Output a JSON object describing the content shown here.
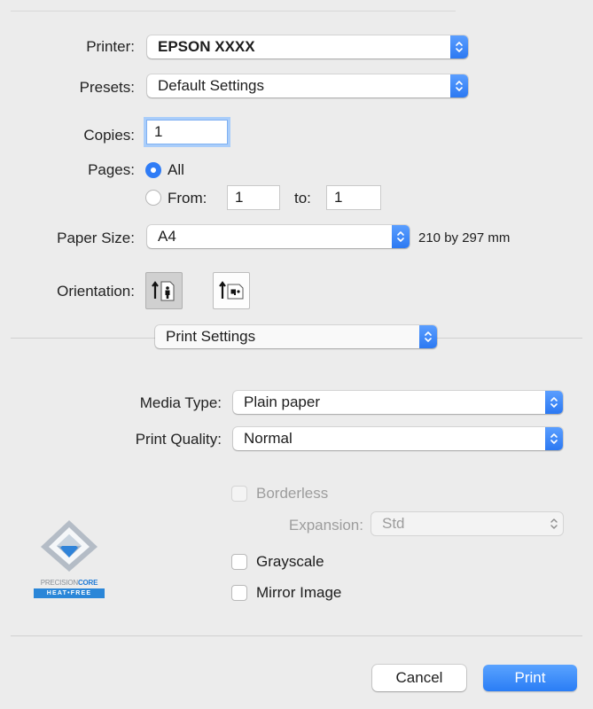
{
  "printer": {
    "label": "Printer:",
    "value": "EPSON XXXX"
  },
  "presets": {
    "label": "Presets:",
    "value": "Default Settings"
  },
  "copies": {
    "label": "Copies:",
    "value": "1"
  },
  "pages": {
    "label": "Pages:",
    "all_label": "All",
    "from_label": "From:",
    "from_value": "1",
    "to_label": "to:",
    "to_value": "1",
    "selected": "All"
  },
  "paper_size": {
    "label": "Paper Size:",
    "value": "A4",
    "dimensions": "210 by 297 mm"
  },
  "orientation": {
    "label": "Orientation:",
    "selected": "portrait"
  },
  "section": {
    "value": "Print Settings"
  },
  "media_type": {
    "label": "Media Type:",
    "value": "Plain paper"
  },
  "print_quality": {
    "label": "Print Quality:",
    "value": "Normal"
  },
  "borderless": {
    "label": "Borderless",
    "checked": false,
    "enabled": false
  },
  "expansion": {
    "label": "Expansion:",
    "value": "Std",
    "enabled": false
  },
  "grayscale": {
    "label": "Grayscale",
    "checked": false
  },
  "mirror": {
    "label": "Mirror Image",
    "checked": false
  },
  "logo": {
    "line1_a": "PRECISION",
    "line1_b": "CORE",
    "line2": "HEAT•FREE"
  },
  "buttons": {
    "cancel": "Cancel",
    "print": "Print"
  },
  "colors": {
    "accent": "#2f7cf6",
    "background": "#ececec"
  }
}
